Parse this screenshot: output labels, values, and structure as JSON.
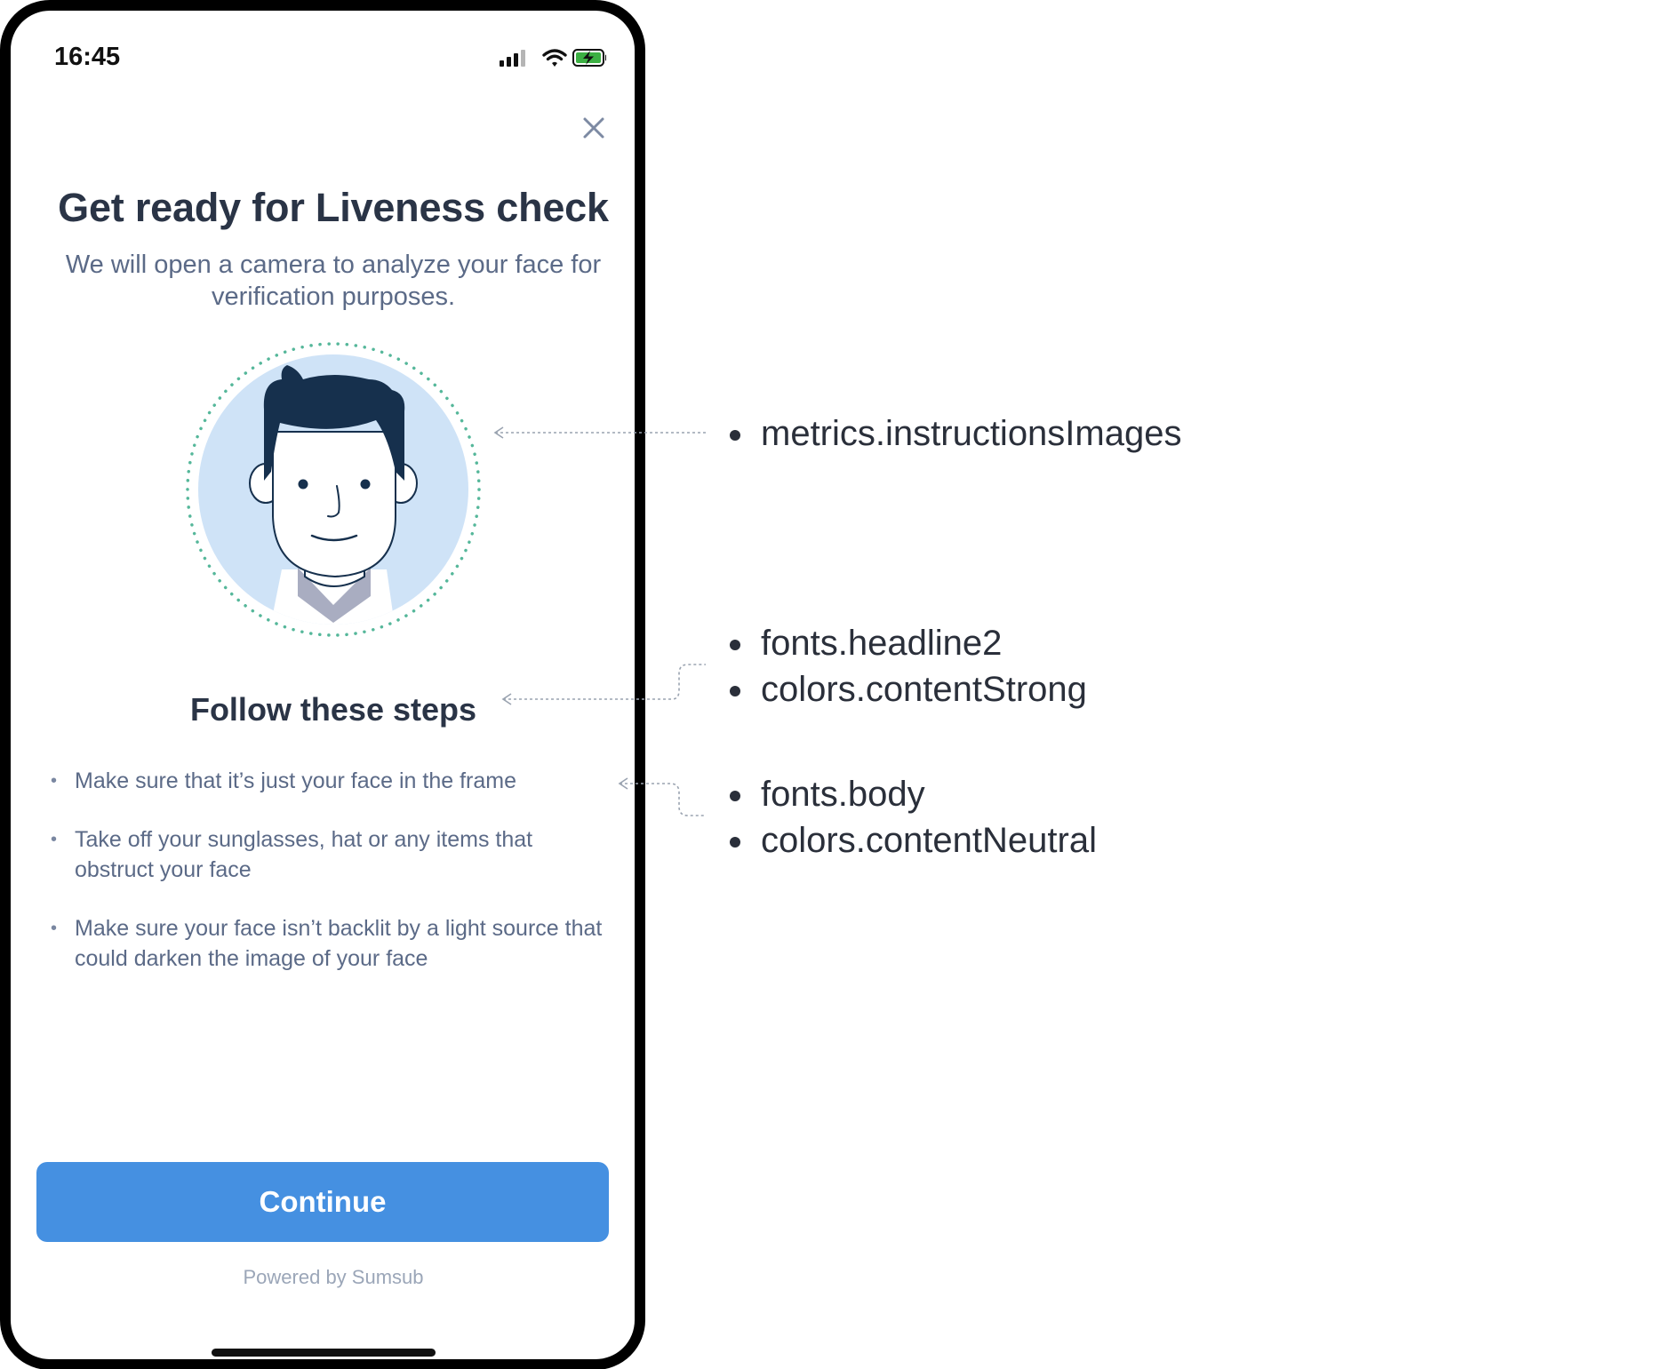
{
  "status_bar": {
    "time": "16:45",
    "icons": [
      "signal-icon",
      "wifi-icon",
      "battery-charging-icon"
    ]
  },
  "screen": {
    "close_icon": "close-icon",
    "title": "Get ready for Liveness check",
    "subtitle": "We will open a camera to analyze your face for verification purposes.",
    "illustration": "face-illustration",
    "steps_heading": "Follow these steps",
    "steps": [
      "Make sure that it’s just your face in the frame",
      "Take off your sunglasses, hat or any items that obstruct your face",
      "Make sure your face isn’t backlit by a light source that could darken the image of your face"
    ],
    "continue_label": "Continue",
    "powered_by": "Powered by Sumsub"
  },
  "annotations": {
    "image": [
      "metrics.instructionsImages"
    ],
    "heading": [
      "fonts.headline2",
      "colors.contentStrong"
    ],
    "body": [
      "fonts.body",
      "colors.contentNeutral"
    ]
  },
  "colors": {
    "accent": "#4590e1",
    "content_strong": "#2a3446",
    "content_neutral": "#5b6a87",
    "dotted_ring": "#55b79a",
    "illustration_bg": "#cfe3f7",
    "hair": "#16304d"
  }
}
